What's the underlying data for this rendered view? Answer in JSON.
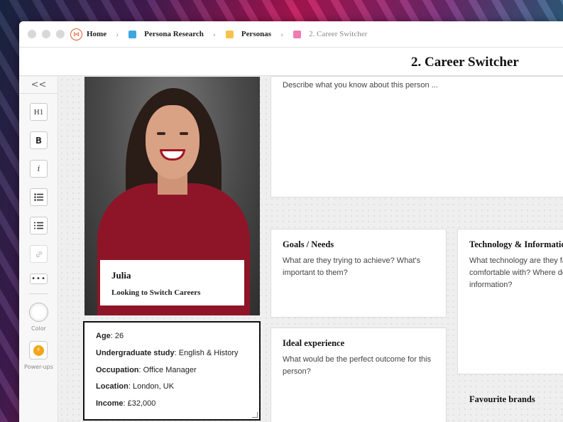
{
  "window": {
    "breadcrumb": [
      {
        "label": "Home",
        "icon": "home-logo-icon",
        "color": "#e25b30"
      },
      {
        "label": "Persona Research",
        "icon": "board-square-icon",
        "color": "#3fa7e0"
      },
      {
        "label": "Personas",
        "icon": "board-square-icon",
        "color": "#f5c34b"
      },
      {
        "label": "2. Career Switcher",
        "icon": "board-square-icon",
        "color": "#f07ab3"
      }
    ]
  },
  "header": {
    "title": "2. Career Switcher"
  },
  "sidebar": {
    "collapse": "<<",
    "tools": [
      "H1",
      "B",
      "i"
    ],
    "color_label": "Color",
    "powerups_label": "Power-ups"
  },
  "persona": {
    "name": "Julia",
    "tagline": "Looking to Switch Careers",
    "details": [
      {
        "key": "Age",
        "value": ": 26"
      },
      {
        "key": "Undergraduate study",
        "value": ": English & History"
      },
      {
        "key": "Occupation",
        "value": ": Office Manager"
      },
      {
        "key": "Location",
        "value": ": London, UK"
      },
      {
        "key": "Income",
        "value": ": £32,000"
      }
    ]
  },
  "cards": {
    "describe": {
      "body": "Describe what you know about this person ..."
    },
    "goals": {
      "title": "Goals / Needs",
      "body": "What are they trying to achieve? What's important to them?"
    },
    "ideal": {
      "title": "Ideal experience",
      "body": "What would be the perfect outcome for this person?"
    },
    "tech": {
      "title": "Technology & Information",
      "body": "What technology are they familiar and comfortable with? Where do they get information?"
    },
    "brands": {
      "title": "Favourite brands"
    }
  }
}
